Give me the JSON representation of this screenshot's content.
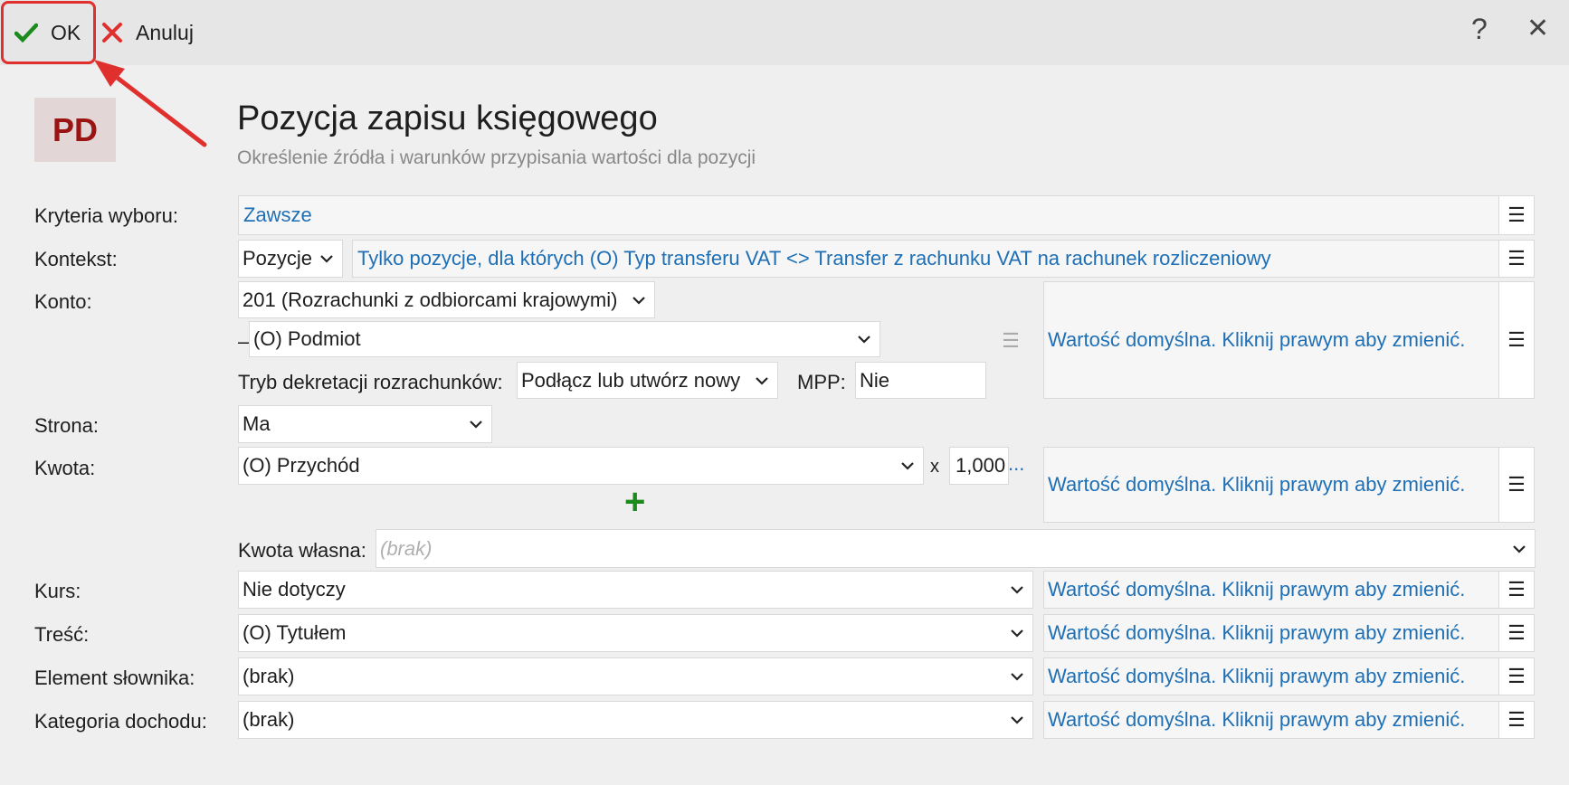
{
  "toolbar": {
    "ok_label": "OK",
    "cancel_label": "Anuluj",
    "help_icon": "?",
    "close_icon": "✕"
  },
  "header": {
    "badge": "PD",
    "title": "Pozycja zapisu księgowego",
    "subtitle": "Określenie źródła i warunków przypisania wartości dla pozycji"
  },
  "form": {
    "criteria": {
      "label": "Kryteria wyboru:",
      "value": "Zawsze"
    },
    "context": {
      "label": "Kontekst:",
      "value": "Pozycje",
      "condition": "Tylko pozycje, dla których (O) Typ transferu VAT <> Transfer z rachunku VAT na rachunek rozliczeniowy"
    },
    "account": {
      "label": "Konto:",
      "value": "201 (Rozrachunki z odbiorcami krajowymi)",
      "dash": "–",
      "sub_value": "(O) Podmiot",
      "mode_label": "Tryb dekretacji rozrachunków:",
      "mode_value": "Podłącz lub utwórz nowy",
      "mpp_label": "MPP:",
      "mpp_value": "Nie",
      "default_text": "Wartość domyślna. Kliknij prawym aby zmienić."
    },
    "side": {
      "label": "Strona:",
      "value": "Ma"
    },
    "amount": {
      "label": "Kwota:",
      "value": "(O) Przychód",
      "times": "x",
      "multiplier": "1,000",
      "more": "...",
      "default_text": "Wartość domyślna. Kliknij prawym aby zmienić."
    },
    "own_amount": {
      "label": "Kwota własna:",
      "placeholder": "(brak)"
    },
    "rate": {
      "label": "Kurs:",
      "value": "Nie dotyczy",
      "default_text": "Wartość domyślna. Kliknij prawym aby zmienić."
    },
    "content": {
      "label": "Treść:",
      "value": "(O) Tytułem",
      "default_text": "Wartość domyślna. Kliknij prawym aby zmienić."
    },
    "dictionary": {
      "label": "Element słownika:",
      "value": "(brak)",
      "default_text": "Wartość domyślna. Kliknij prawym aby zmienić."
    },
    "income_category": {
      "label": "Kategoria dochodu:",
      "value": "(brak)",
      "default_text": "Wartość domyślna. Kliknij prawym aby zmienić."
    }
  },
  "colors": {
    "link": "#1f6fb5",
    "ok_check": "#1d8a1d",
    "cancel_x": "#e0302e",
    "badge_text": "#9a1414",
    "badge_bg": "#e3d6d6",
    "highlight": "#e0302e"
  }
}
